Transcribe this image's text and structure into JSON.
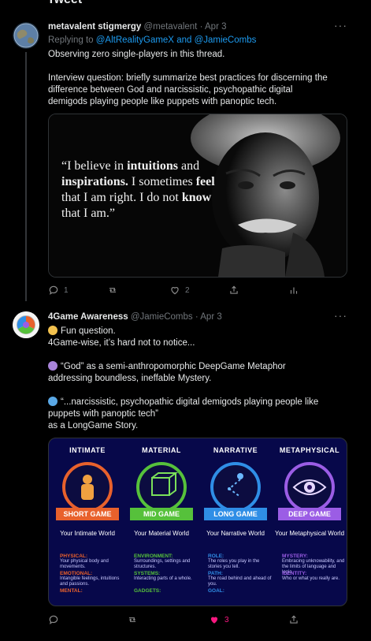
{
  "header": {
    "title": "Tweet"
  },
  "tweet1": {
    "name": "metavalent stigmergy",
    "handle": "@metavalent",
    "date": "Apr 3",
    "reply_prefix": "Replying to",
    "reply_to_1": "@AltRealityGameX",
    "reply_and": "and",
    "reply_to_2": "@JamieCombs",
    "text_1": "Observing zero single-players in this thread.",
    "text_2": "Interview question: briefly summarize best practices for discerning the difference between God and narcissistic, psychopathic digital demigods playing people like puppets with panoptic tech.",
    "image": {
      "quote_1": "“I believe in ",
      "quote_b1": "intuitions",
      "quote_2": " and ",
      "quote_b2": "inspirations.",
      "quote_3": " I sometimes ",
      "quote_b3": "feel",
      "quote_4": " that I am right. I do not ",
      "quote_b4": "know",
      "quote_5": " that I am.”"
    },
    "replies": "1",
    "retweets": "",
    "likes": "2"
  },
  "tweet2": {
    "name": "4Game Awareness",
    "handle": "@JamieCombs",
    "date": "Apr 3",
    "line_1": "Fun question.",
    "line_2": "4Game-wise, it’s hard not to notice...",
    "para_2": "“God” as a semi-anthropomorphic DeepGame Metaphor addressing boundless, ineffable Mystery.",
    "para_3a": "“...narcissistic, psychopathic digital demigods playing people like puppets with panoptic tech”",
    "para_3b": "as a LongGame Story.",
    "likes": "3",
    "colors": {
      "purple": "#a884d9",
      "blue": "#5aa8e6",
      "yellow": "#f2c14e",
      "like": "#f91880"
    },
    "infographic": {
      "columns": [
        {
          "head": "INTIMATE",
          "tag": "SHORT GAME",
          "world": "Your Intimate World",
          "color": "#e8612c",
          "items": [
            {
              "title": "PHYSICAL:",
              "desc": "Your physical body and movements."
            },
            {
              "title": "EMOTIONAL:",
              "desc": "Intangible feelings, intuitions and passions."
            },
            {
              "title": "MENTAL:",
              "desc": ""
            }
          ]
        },
        {
          "head": "MATERIAL",
          "tag": "MID GAME",
          "world": "Your Material World",
          "color": "#56c13b",
          "items": [
            {
              "title": "ENVIRONMENT:",
              "desc": "Surroundings, settings and structures."
            },
            {
              "title": "SYSTEMS:",
              "desc": "Interacting parts of a whole."
            },
            {
              "title": "GADGETS:",
              "desc": ""
            }
          ]
        },
        {
          "head": "NARRATIVE",
          "tag": "LONG GAME",
          "world": "Your Narrative World",
          "color": "#2f8ee6",
          "items": [
            {
              "title": "ROLE:",
              "desc": "The roles you play in the stories you tell."
            },
            {
              "title": "PATH:",
              "desc": "The road behind and ahead of you."
            },
            {
              "title": "GOAL:",
              "desc": ""
            }
          ]
        },
        {
          "head": "METAPHYSICAL",
          "tag": "DEEP GAME",
          "world": "Your Metaphysical World",
          "color": "#9b5de5",
          "items": [
            {
              "title": "MYSTERY:",
              "desc": "Embracing unknowability, and the limits of language and logic."
            },
            {
              "title": "IDENTITY:",
              "desc": "Who or what you really are."
            }
          ]
        }
      ]
    }
  }
}
